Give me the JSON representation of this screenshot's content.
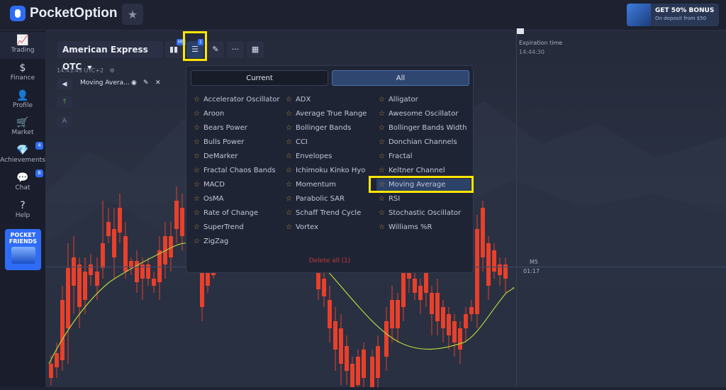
{
  "app": {
    "brand": "PocketOption",
    "logo_icon": "pocket-option-logo-icon",
    "favorites_icon": "star-icon"
  },
  "promo": {
    "title": "GET 50% BONUS",
    "subtitle": "On deposit from $50"
  },
  "sidebar": {
    "items": [
      {
        "label": "Trading",
        "icon": "chart-line-icon",
        "glyph": "📈"
      },
      {
        "label": "Finance",
        "icon": "dollar-icon",
        "glyph": "$"
      },
      {
        "label": "Profile",
        "icon": "user-icon",
        "glyph": "👤"
      },
      {
        "label": "Market",
        "icon": "cart-icon",
        "glyph": "🛒"
      },
      {
        "label": "Achievements",
        "icon": "diamond-icon",
        "glyph": "💎",
        "badge": "4"
      },
      {
        "label": "Chat",
        "icon": "chat-bubbles-icon",
        "glyph": "💬",
        "badge": "8"
      },
      {
        "label": "Help",
        "icon": "question-icon",
        "glyph": "?"
      }
    ],
    "pocket_friends": "POCKET FRIENDS"
  },
  "toolbar": {
    "asset": "American Express OTC",
    "timeframe_badge": "M5",
    "indicators_badge": "1"
  },
  "chart": {
    "timestamp": "14:43:43 UTC+2",
    "active_indicator": "Moving Avera...",
    "expiration_label": "Expiration time",
    "expiration_time": "14:44:30",
    "period": "M5",
    "timer": "01:17"
  },
  "indicators_panel": {
    "tabs": [
      "Current",
      "All"
    ],
    "active_tab": "All",
    "items": [
      "Accelerator Oscillator",
      "ADX",
      "Alligator",
      "Aroon",
      "Average True Range",
      "Awesome Oscillator",
      "Bears Power",
      "Bollinger Bands",
      "Bollinger Bands Width",
      "Bulls Power",
      "CCI",
      "Donchian Channels",
      "DeMarker",
      "Envelopes",
      "Fractal",
      "Fractal Chaos Bands",
      "Ichimoku Kinko Hyo",
      "Keltner Channel",
      "MACD",
      "Momentum",
      "Moving Average",
      "OsMA",
      "Parabolic SAR",
      "RSI",
      "Rate of Change",
      "Schaff Trend Cycle",
      "Stochastic Oscillator",
      "SuperTrend",
      "Vortex",
      "Williams %R",
      "ZigZag"
    ],
    "selected": "Moving Average",
    "delete_all": "Delete all (1)"
  },
  "colors": {
    "up": "#3fb23a",
    "down": "#e8402b",
    "accent": "#2f6cf6",
    "highlight": "#ffe600",
    "ma_line": "#b7d43b"
  }
}
